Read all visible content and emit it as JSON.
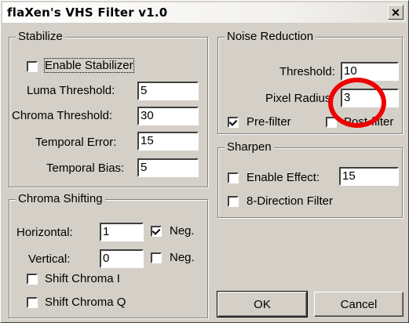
{
  "window": {
    "title": "flaXen's VHS Filter v1.0"
  },
  "stabilize": {
    "title": "Stabilize",
    "enable_label": "Enable Stabilizer",
    "enable_checked": false,
    "luma_label": "Luma Threshold:",
    "luma_value": "5",
    "chroma_label": "Chroma Threshold:",
    "chroma_value": "30",
    "temporal_error_label": "Temporal Error:",
    "temporal_error_value": "15",
    "temporal_bias_label": "Temporal Bias:",
    "temporal_bias_value": "5"
  },
  "chroma_shifting": {
    "title": "Chroma Shifting",
    "horizontal_label": "Horizontal:",
    "horizontal_value": "1",
    "horizontal_neg_label": "Neg.",
    "horizontal_neg_checked": true,
    "vertical_label": "Vertical:",
    "vertical_value": "0",
    "vertical_neg_label": "Neg.",
    "vertical_neg_checked": false,
    "shift_i_label": "Shift Chroma I",
    "shift_i_checked": false,
    "shift_q_label": "Shift Chroma Q",
    "shift_q_checked": false
  },
  "noise_reduction": {
    "title": "Noise Reduction",
    "threshold_label": "Threshold:",
    "threshold_value": "10",
    "pixel_radius_label": "Pixel Radius:",
    "pixel_radius_value": "3",
    "prefilter_label": "Pre-filter",
    "prefilter_checked": true,
    "postfilter_label": "Post-filter",
    "postfilter_checked": false
  },
  "sharpen": {
    "title": "Sharpen",
    "enable_label": "Enable Effect:",
    "enable_checked": false,
    "enable_value": "15",
    "eight_dir_label": "8-Direction Filter",
    "eight_dir_checked": false
  },
  "buttons": {
    "ok": "OK",
    "cancel": "Cancel"
  },
  "annotation": {
    "color": "#ee0000"
  }
}
